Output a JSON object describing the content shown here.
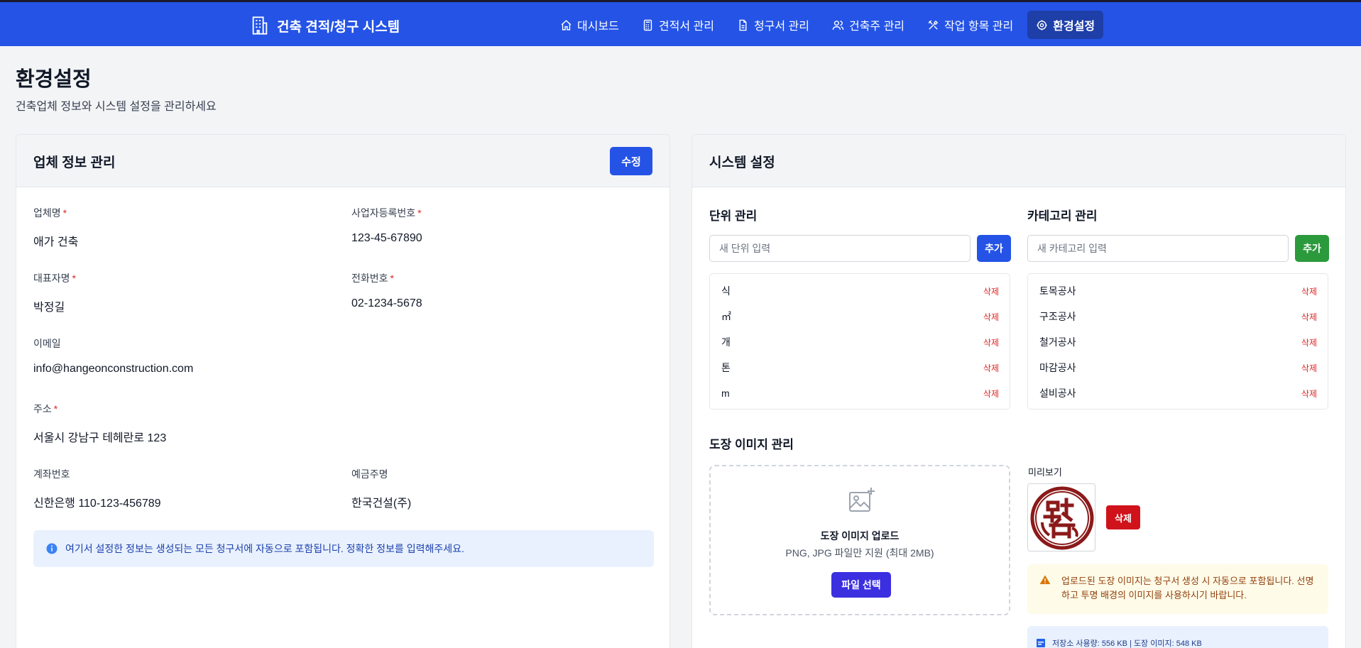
{
  "app": {
    "title": "건축 견적/청구 시스템"
  },
  "nav": [
    {
      "label": "대시보드",
      "icon": "home-icon"
    },
    {
      "label": "견적서 관리",
      "icon": "calculator-icon"
    },
    {
      "label": "청구서 관리",
      "icon": "file-text-icon"
    },
    {
      "label": "건축주 관리",
      "icon": "users-icon"
    },
    {
      "label": "작업 항목 관리",
      "icon": "tools-icon"
    },
    {
      "label": "환경설정",
      "icon": "gear-icon",
      "active": true
    }
  ],
  "page": {
    "title": "환경설정",
    "subtitle": "건축업체 정보와 시스템 설정을 관리하세요"
  },
  "company": {
    "title": "업체 정보 관리",
    "edit_label": "수정",
    "fields": {
      "name": {
        "label": "업체명",
        "value": "애가 건축",
        "required": true
      },
      "biz_no": {
        "label": "사업자등록번호",
        "value": "123-45-67890",
        "required": true
      },
      "ceo": {
        "label": "대표자명",
        "value": "박정길",
        "required": true
      },
      "phone": {
        "label": "전화번호",
        "value": "02-1234-5678",
        "required": true
      },
      "email": {
        "label": "이메일",
        "value": "info@hangeonconstruction.com",
        "required": false
      },
      "address": {
        "label": "주소",
        "value": "서울시 강남구 테헤란로 123",
        "required": true
      },
      "account": {
        "label": "계좌번호",
        "value": "신한은행 110-123-456789",
        "required": false
      },
      "holder": {
        "label": "예금주명",
        "value": "한국건설(주)",
        "required": false
      }
    },
    "required_mark": "*",
    "info": "여기서 설정한 정보는 생성되는 모든 청구서에 자동으로 포함됩니다. 정확한 정보를 입력해주세요."
  },
  "system": {
    "title": "시스템 설정",
    "units": {
      "title": "단위 관리",
      "placeholder": "새 단위 입력",
      "add_label": "추가",
      "items": [
        "식",
        "㎡",
        "개",
        "톤",
        "m"
      ],
      "delete_label": "삭제"
    },
    "categories": {
      "title": "카테고리 관리",
      "placeholder": "새 카테고리 입력",
      "add_label": "추가",
      "items": [
        "토목공사",
        "구조공사",
        "철거공사",
        "마감공사",
        "설비공사"
      ],
      "delete_label": "삭제"
    },
    "stamp": {
      "title": "도장 이미지 관리",
      "upload_title": "도장 이미지 업로드",
      "upload_hint": "PNG, JPG 파일만 지원 (최대 2MB)",
      "file_button": "파일 선택",
      "preview_label": "미리보기",
      "delete_label": "삭제",
      "warning": "업로드된 도장 이미지는 청구서 생성 시 자동으로 포함됩니다. 선명하고 투명 배경의 이미지를 사용하시기 바랍니다.",
      "storage": "저장소 사용량: 556 KB | 도장 이미지: 548 KB"
    }
  },
  "colors": {
    "primary": "#2453e6",
    "nav_active": "#1e3ea8",
    "danger": "#d0121b",
    "success": "#2b9a3c",
    "file_button": "#3b2fe0",
    "stamp_red": "#8b1a1a"
  }
}
